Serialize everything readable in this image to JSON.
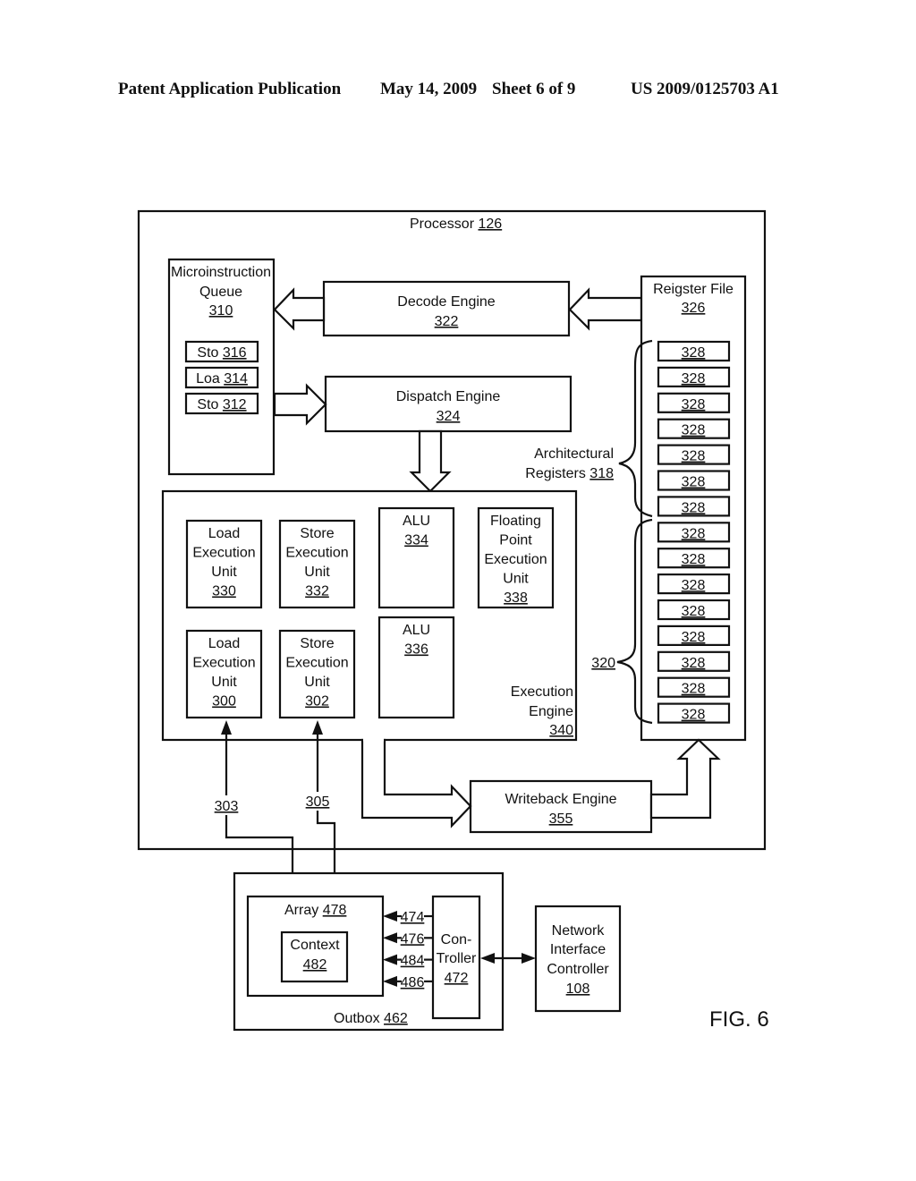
{
  "header": {
    "left": "Patent Application Publication",
    "date": "May 14, 2009",
    "sheet": "Sheet 6 of 9",
    "number": "US 2009/0125703 A1"
  },
  "processor": {
    "label": "Processor",
    "ref": "126"
  },
  "microinstruction_queue": {
    "lines": [
      "Microinstruction",
      "Queue"
    ],
    "ref": "310",
    "entries": [
      {
        "label": "Sto",
        "ref": "316"
      },
      {
        "label": "Loa",
        "ref": "314"
      },
      {
        "label": "Sto",
        "ref": "312"
      }
    ]
  },
  "decode_engine": {
    "label": "Decode Engine",
    "ref": "322"
  },
  "dispatch_engine": {
    "label": "Dispatch Engine",
    "ref": "324"
  },
  "register_file": {
    "label": "Reigster File",
    "ref": "326",
    "registers": [
      "328",
      "328",
      "328",
      "328",
      "328",
      "328",
      "328",
      "328",
      "328",
      "328",
      "328",
      "328",
      "328",
      "328",
      "328"
    ],
    "architectural": {
      "lines": [
        "Architectural",
        "Registers"
      ],
      "ref": "318"
    },
    "other_ref": "320"
  },
  "execution_engine": {
    "lines": [
      "Execution",
      "Engine"
    ],
    "ref": "340",
    "units": [
      {
        "lines": [
          "Load",
          "Execution",
          "Unit"
        ],
        "ref": "330"
      },
      {
        "lines": [
          "Store",
          "Execution",
          "Unit"
        ],
        "ref": "332"
      },
      {
        "lines": [
          "ALU"
        ],
        "ref": "334"
      },
      {
        "lines": [
          "Floating",
          "Point",
          "Execution",
          "Unit"
        ],
        "ref": "338"
      },
      {
        "lines": [
          "Load",
          "Execution",
          "Unit"
        ],
        "ref": "300"
      },
      {
        "lines": [
          "Store",
          "Execution",
          "Unit"
        ],
        "ref": "302"
      },
      {
        "lines": [
          "ALU"
        ],
        "ref": "336"
      }
    ]
  },
  "writeback_engine": {
    "label": "Writeback Engine",
    "ref": "355"
  },
  "links": {
    "load_link": "303",
    "store_link": "305"
  },
  "outbox": {
    "label": "Outbox",
    "ref": "462",
    "array": {
      "label": "Array",
      "ref": "478"
    },
    "context": {
      "label": "Context",
      "ref": "482"
    },
    "controller": {
      "lines": [
        "Con-",
        "Troller"
      ],
      "ref": "472"
    },
    "signals": [
      "474",
      "476",
      "484",
      "486"
    ]
  },
  "nic": {
    "lines": [
      "Network",
      "Interface",
      "Controller"
    ],
    "ref": "108"
  },
  "figure_label": "FIG. 6"
}
